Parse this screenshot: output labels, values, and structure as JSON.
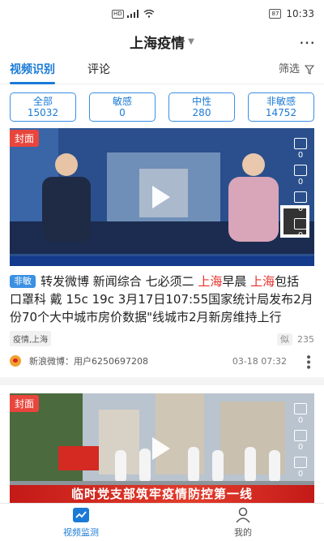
{
  "status_bar": {
    "network": "HD",
    "battery": "87",
    "time": "10:33"
  },
  "header": {
    "title": "上海疫情",
    "more_icon": "more-horizontal-icon"
  },
  "tabs": [
    {
      "label": "视频识别",
      "active": true
    },
    {
      "label": "评论",
      "active": false
    }
  ],
  "filter": {
    "label": "筛选",
    "icon": "filter-funnel-icon"
  },
  "stats": [
    {
      "label": "全部",
      "value": "15032"
    },
    {
      "label": "敏感",
      "value": "0"
    },
    {
      "label": "中性",
      "value": "280"
    },
    {
      "label": "非敏感",
      "value": "14752"
    }
  ],
  "cards": [
    {
      "cover_badge": "封面",
      "side_counts": [
        "0",
        "0",
        "0",
        "0"
      ],
      "headline_tag": "非敏",
      "headline_before": "转发微博 新闻综合 七必须二 ",
      "headline_highlight_1": "上海",
      "headline_mid": "早晨 ",
      "headline_highlight_2": "上海",
      "headline_after": "包括 口罩科 戴 15c 19c 3月17日107:55国家统计局发布2月份70个大中城市房价数据\"线城市2月新房维持上行",
      "keywords": "疫情,上海",
      "similar_label": "似",
      "similar_count": "235",
      "source": "新浪微博：用户6250697208",
      "time": "03-18 07:32"
    },
    {
      "cover_badge": "封面",
      "side_counts": [
        "0",
        "0",
        "0"
      ],
      "banner_text": "临时党支部筑牢疫情防控第一线"
    }
  ],
  "bottom_nav": [
    {
      "label": "视频监测",
      "icon": "monitor-chart-icon",
      "active": true
    },
    {
      "label": "我的",
      "icon": "user-profile-icon",
      "active": false
    }
  ],
  "colors": {
    "accent": "#1a7ad6",
    "highlight": "#e8302a",
    "badge": "#e8453c"
  }
}
